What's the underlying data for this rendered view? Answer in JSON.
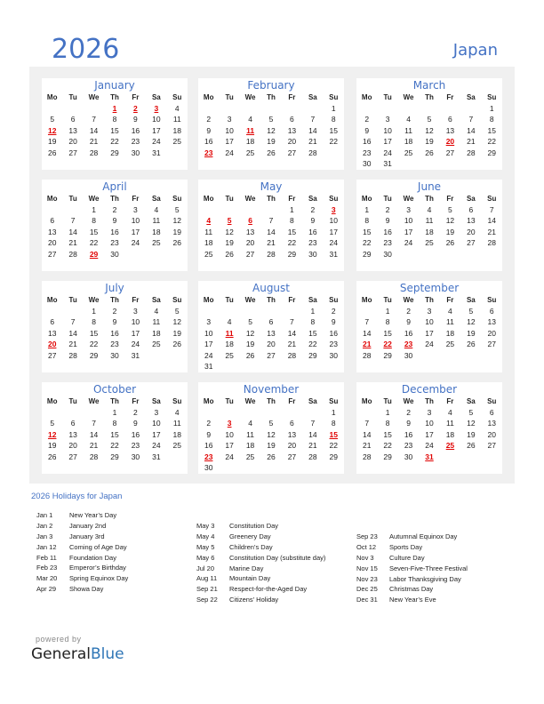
{
  "header": {
    "year": "2026",
    "country": "Japan"
  },
  "weekdays": [
    "Mo",
    "Tu",
    "We",
    "Th",
    "Fr",
    "Sa",
    "Su"
  ],
  "colors": {
    "accent": "#4472c4",
    "holiday": "#e00000",
    "frame": "#f0f0f0"
  },
  "months": [
    {
      "name": "January",
      "offset": 3,
      "days": 31,
      "holidays": [
        1,
        2,
        3,
        12
      ]
    },
    {
      "name": "February",
      "offset": 6,
      "days": 28,
      "holidays": [
        11,
        23
      ]
    },
    {
      "name": "March",
      "offset": 6,
      "days": 31,
      "holidays": [
        20
      ]
    },
    {
      "name": "April",
      "offset": 2,
      "days": 30,
      "holidays": [
        29
      ]
    },
    {
      "name": "May",
      "offset": 4,
      "days": 31,
      "holidays": [
        3,
        4,
        5,
        6
      ]
    },
    {
      "name": "June",
      "offset": 0,
      "days": 30,
      "holidays": []
    },
    {
      "name": "July",
      "offset": 2,
      "days": 31,
      "holidays": [
        20
      ]
    },
    {
      "name": "August",
      "offset": 5,
      "days": 31,
      "holidays": [
        11
      ]
    },
    {
      "name": "September",
      "offset": 1,
      "days": 30,
      "holidays": [
        21,
        22,
        23
      ]
    },
    {
      "name": "October",
      "offset": 3,
      "days": 31,
      "holidays": [
        12
      ]
    },
    {
      "name": "November",
      "offset": 6,
      "days": 30,
      "holidays": [
        3,
        15,
        23
      ]
    },
    {
      "name": "December",
      "offset": 1,
      "days": 31,
      "holidays": [
        25,
        31
      ]
    }
  ],
  "holidays_title": "2026 Holidays for Japan",
  "holiday_columns": [
    [
      {
        "date": "Jan 1",
        "name": "New Year’s Day"
      },
      {
        "date": "Jan 2",
        "name": "January 2nd"
      },
      {
        "date": "Jan 3",
        "name": "January 3rd"
      },
      {
        "date": "Jan 12",
        "name": "Coming of Age Day"
      },
      {
        "date": "Feb 11",
        "name": "Foundation Day"
      },
      {
        "date": "Feb 23",
        "name": "Emperor’s Birthday"
      },
      {
        "date": "Mar 20",
        "name": "Spring Equinox Day"
      },
      {
        "date": "Apr 29",
        "name": "Showa Day"
      }
    ],
    [
      {
        "date": "May 3",
        "name": "Constitution Day"
      },
      {
        "date": "May 4",
        "name": "Greenery Day"
      },
      {
        "date": "May 5",
        "name": "Children’s Day"
      },
      {
        "date": "May 6",
        "name": "Constitution Day (substitute day)"
      },
      {
        "date": "Jul 20",
        "name": "Marine Day"
      },
      {
        "date": "Aug 11",
        "name": "Mountain Day"
      },
      {
        "date": "Sep 21",
        "name": "Respect-for-the-Aged Day"
      },
      {
        "date": "Sep 22",
        "name": "Citizens’ Holiday"
      }
    ],
    [
      {
        "date": "Sep 23",
        "name": "Autumnal Equinox Day"
      },
      {
        "date": "Oct 12",
        "name": "Sports Day"
      },
      {
        "date": "Nov 3",
        "name": "Culture Day"
      },
      {
        "date": "Nov 15",
        "name": "Seven-Five-Three Festival"
      },
      {
        "date": "Nov 23",
        "name": "Labor Thanksgiving Day"
      },
      {
        "date": "Dec 25",
        "name": "Christmas Day"
      },
      {
        "date": "Dec 31",
        "name": "New Year’s Eve"
      }
    ]
  ],
  "footer": {
    "powered_by": "powered by",
    "brand_general": "General",
    "brand_blue": "Blue"
  }
}
